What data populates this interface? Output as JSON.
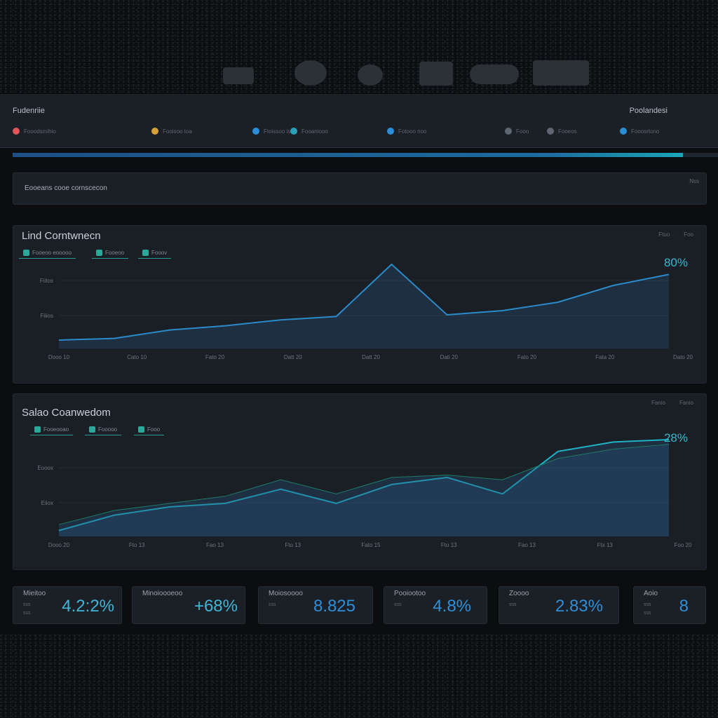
{
  "header": {
    "brand": "Fudenriie",
    "profile": "Poolandesi",
    "nav": [
      {
        "label": "Fooodsmihio",
        "color": "#e0565b"
      },
      {
        "label": "Fooisoo toa",
        "color": "#d7a23a"
      },
      {
        "label": "Ftoissoo iso",
        "color": "#2a8fd6"
      },
      {
        "label": "Fooaniooo",
        "color": "#2aa0b8"
      },
      {
        "label": "Fotooo noo",
        "color": "#2a8fd6"
      },
      {
        "label": "Fooo",
        "color": "#5f6872"
      },
      {
        "label": "Fooeos",
        "color": "#5f6872"
      },
      {
        "label": "Fooosrtono",
        "color": "#2a8fd6"
      }
    ]
  },
  "progress": {
    "value": 0.95
  },
  "breadcrumb": {
    "text": "Eooeans  cooe cornscecon",
    "right": "Nss"
  },
  "panels": [
    {
      "title": "Lind Corntwnecn",
      "actions": [
        "Ftuo",
        "Foo"
      ],
      "chips": [
        "Fooeoo eooooo",
        "Fooeoo",
        "Fooov"
      ],
      "value_label": "80%"
    },
    {
      "title": "Salao Coanwedom",
      "actions": [
        "Fanio",
        "Fanio"
      ],
      "chips": [
        "Fooeooao",
        "Fooooo",
        "Fooo"
      ],
      "value_label": "28%"
    }
  ],
  "chart_data": [
    {
      "type": "area",
      "title": "Lind Corntwnecn",
      "y_tick_labels": [
        "Fiitos",
        "Fiiios"
      ],
      "x": [
        "Dooo 10",
        "Cato 10",
        "Fato 20",
        "Datt 20",
        "Datt 20",
        "Dati 20",
        "Fato 20",
        "Fata 20",
        "Dato 20"
      ],
      "series": [
        {
          "values": [
            10,
            12,
            22,
            27,
            34,
            38,
            100,
            40,
            45,
            55,
            75,
            88
          ]
        }
      ],
      "end_label": "80%"
    },
    {
      "type": "area",
      "title": "Salao Coanwedom",
      "y_tick_labels": [
        "Eooox",
        "Eiiox"
      ],
      "x": [
        "Dooo 20",
        "Fto 13",
        "Fao 13",
        "Fto 13",
        "Fato 15",
        "Fto 13",
        "Fao 13",
        "Ftx 13",
        "Foo 20"
      ],
      "series": [
        {
          "values": [
            5,
            18,
            25,
            28,
            40,
            28,
            44,
            50,
            36,
            72,
            80,
            82
          ]
        },
        {
          "values": [
            10,
            22,
            28,
            34,
            48,
            36,
            50,
            52,
            48,
            66,
            74,
            78
          ]
        }
      ],
      "end_label": "28%"
    }
  ],
  "metrics": [
    {
      "label": "Mieitoo",
      "sub1": "sss",
      "sub2": "sss",
      "value": "4.2:2%"
    },
    {
      "label": "Minoioooeoo",
      "sub1": "",
      "sub2": "",
      "value": "+68%"
    },
    {
      "label": "Moiosoooo",
      "sub1": "sss",
      "sub2": "",
      "value": "8.825"
    },
    {
      "label": "Pooiootoo",
      "sub1": "sss",
      "sub2": "",
      "value": "4.8%"
    },
    {
      "label": "Zoooo",
      "sub1": "sss",
      "sub2": "",
      "value": "2.83%"
    },
    {
      "label": "Aoio",
      "sub1": "sss",
      "sub2": "sss",
      "value": "8"
    }
  ]
}
